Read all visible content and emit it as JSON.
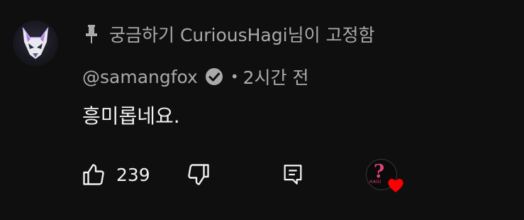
{
  "pinned": {
    "icon": "pin-icon",
    "text": "궁금하기 CuriousHagi님이 고정함"
  },
  "author": {
    "avatar_icon": "fox-avatar-icon",
    "handle": "@samangfox",
    "verified_icon": "verified-check-icon",
    "separator": "•",
    "time": "2시간 전"
  },
  "comment": {
    "text": "흥미롭네요."
  },
  "actions": {
    "like_icon": "thumbs-up-icon",
    "like_count": "239",
    "dislike_icon": "thumbs-down-icon",
    "reply_icon": "reply-icon",
    "creator_heart_icon": "creator-heart-icon"
  },
  "colors": {
    "background": "#0f0f0f",
    "primary_text": "#f1f1f1",
    "secondary_text": "#aaaaaa",
    "heart": "#ff0000"
  }
}
